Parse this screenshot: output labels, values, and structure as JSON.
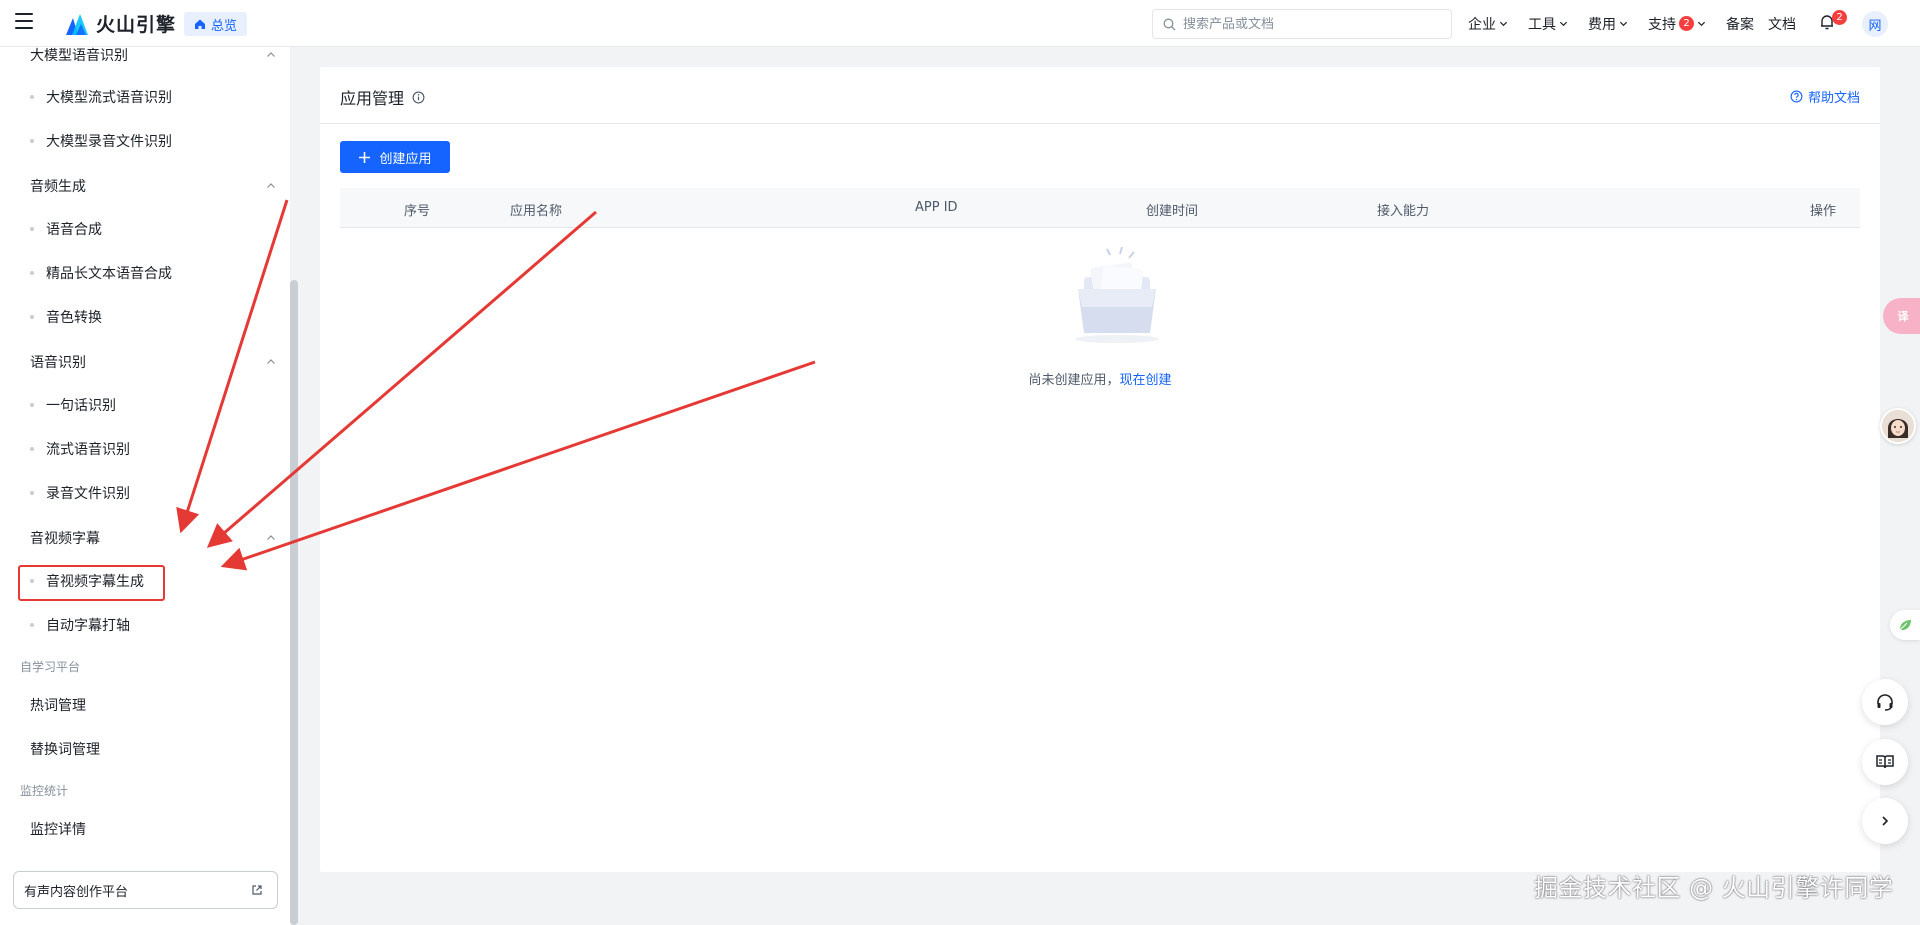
{
  "topbar": {
    "brand": "火山引擎",
    "overview_label": "总览",
    "search_placeholder": "搜索产品或文档",
    "nav": [
      {
        "label": "企业",
        "has_dropdown": true
      },
      {
        "label": "工具",
        "has_dropdown": true
      },
      {
        "label": "费用",
        "has_dropdown": true
      },
      {
        "label": "支持",
        "has_dropdown": true,
        "badge": "2"
      },
      {
        "label": "备案",
        "has_dropdown": false
      },
      {
        "label": "文档",
        "has_dropdown": false
      }
    ],
    "bell_badge": "2",
    "avatar_text": "网"
  },
  "sidebar": {
    "groups": [
      {
        "title": "大模型语音识别",
        "items": [
          "大模型流式语音识别",
          "大模型录音文件识别"
        ]
      },
      {
        "title": "音频生成",
        "items": [
          "语音合成",
          "精品长文本语音合成",
          "音色转换"
        ]
      },
      {
        "title": "语音识别",
        "items": [
          "一句话识别",
          "流式语音识别",
          "录音文件识别"
        ]
      },
      {
        "title": "音视频字幕",
        "items": [
          "音视频字幕生成",
          "自动字幕打轴"
        ]
      }
    ],
    "sections": [
      {
        "title": "自学习平台",
        "items": [
          "热词管理",
          "替换词管理"
        ]
      },
      {
        "title": "监控统计",
        "items": [
          "监控详情"
        ]
      }
    ],
    "bottom_link": "有声内容创作平台",
    "highlighted_item": "音视频字幕生成"
  },
  "main": {
    "title": "应用管理",
    "help_label": "帮助文档",
    "create_button": "创建应用",
    "columns": [
      "序号",
      "应用名称",
      "APP ID",
      "创建时间",
      "接入能力",
      "操作"
    ],
    "empty_text": "尚未创建应用，",
    "empty_link": "现在创建"
  },
  "floating": {
    "translate_label": "译",
    "icons": [
      "headset-icon",
      "book-icon",
      "chevron-right-icon"
    ]
  },
  "watermark": "掘金技术社区 @ 火山引擎许同学",
  "colors": {
    "primary": "#1664ff",
    "annotation_red": "#e53935",
    "badge_red": "#f53f3f"
  }
}
